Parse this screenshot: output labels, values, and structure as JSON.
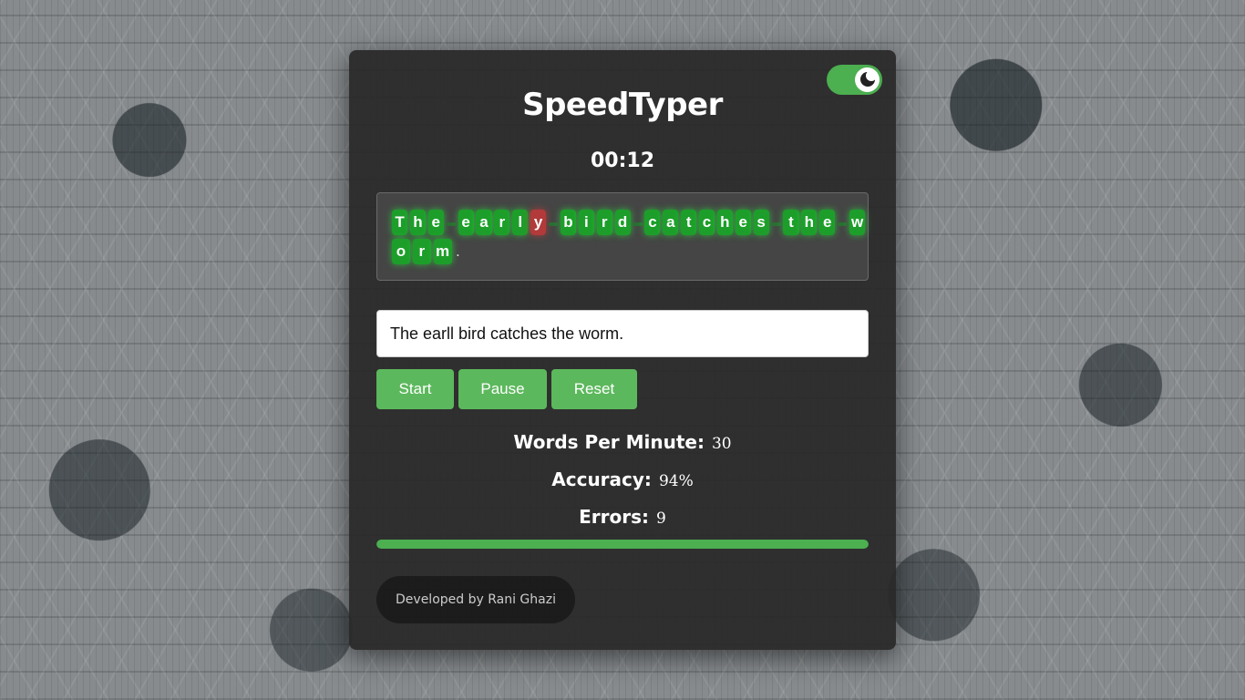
{
  "app": {
    "title": "SpeedTyper",
    "timer": "00:12"
  },
  "quote": {
    "line1": [
      {
        "c": "T",
        "s": "ok"
      },
      {
        "c": "h",
        "s": "ok"
      },
      {
        "c": "e",
        "s": "ok"
      },
      {
        "c": " ",
        "s": "sp"
      },
      {
        "c": "e",
        "s": "ok"
      },
      {
        "c": "a",
        "s": "ok"
      },
      {
        "c": "r",
        "s": "ok"
      },
      {
        "c": "l",
        "s": "ok"
      },
      {
        "c": "y",
        "s": "err"
      },
      {
        "c": " ",
        "s": "sp"
      },
      {
        "c": "b",
        "s": "ok"
      },
      {
        "c": "i",
        "s": "ok"
      },
      {
        "c": "r",
        "s": "ok"
      },
      {
        "c": "d",
        "s": "ok"
      },
      {
        "c": " ",
        "s": "sp"
      },
      {
        "c": "c",
        "s": "ok"
      },
      {
        "c": "a",
        "s": "ok"
      },
      {
        "c": "t",
        "s": "ok"
      },
      {
        "c": "c",
        "s": "ok"
      },
      {
        "c": "h",
        "s": "ok"
      },
      {
        "c": "e",
        "s": "ok"
      },
      {
        "c": "s",
        "s": "ok"
      },
      {
        "c": " ",
        "s": "sp"
      },
      {
        "c": "t",
        "s": "ok"
      },
      {
        "c": "h",
        "s": "ok"
      },
      {
        "c": "e",
        "s": "ok"
      },
      {
        "c": " ",
        "s": "sp"
      },
      {
        "c": "w",
        "s": "ok"
      }
    ],
    "line2": [
      {
        "c": "o",
        "s": "ok"
      },
      {
        "c": "r",
        "s": "ok"
      },
      {
        "c": "m",
        "s": "ok"
      },
      {
        "c": ".",
        "s": "plain"
      }
    ]
  },
  "input": {
    "value": "The earll bird catches the worm."
  },
  "buttons": {
    "start": "Start",
    "pause": "Pause",
    "reset": "Reset"
  },
  "stats": {
    "wpm_label": "Words Per Minute:",
    "wpm_value": "30",
    "accuracy_label": "Accuracy:",
    "accuracy_value": "94%",
    "errors_label": "Errors:",
    "errors_value": "9"
  },
  "progress": {
    "percent": 100
  },
  "footer": {
    "credit": "Developed by Rani Ghazi"
  },
  "colors": {
    "accent": "#4caf50",
    "button": "#5cb85c",
    "correct": "#1d9e2a",
    "error": "#b23a3a"
  }
}
